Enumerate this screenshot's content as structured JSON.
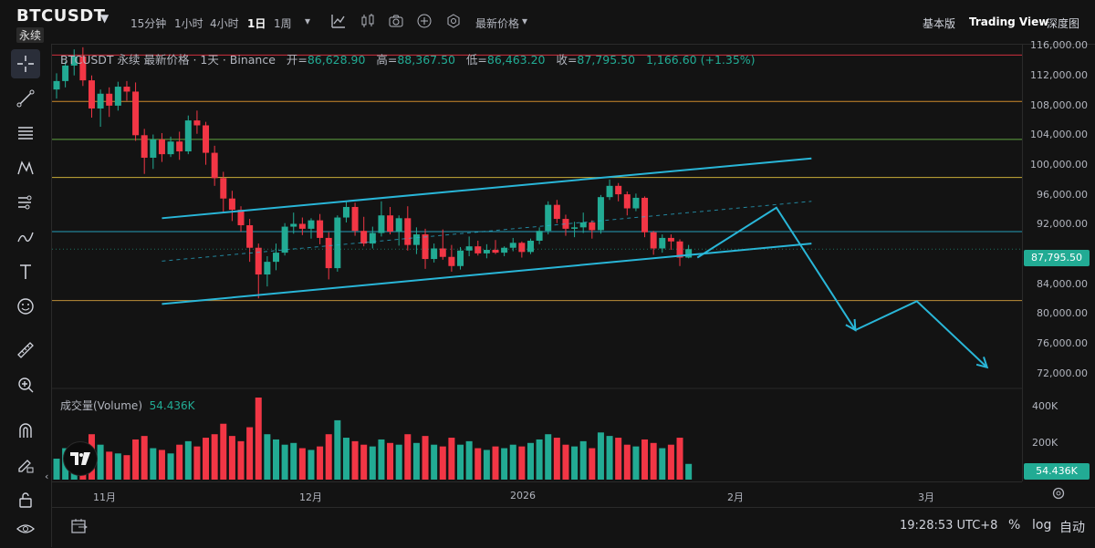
{
  "header": {
    "symbol": "BTCUSDT",
    "contract": "永续",
    "timeframes": [
      "15分钟",
      "1小时",
      "4小时",
      "1日",
      "1周"
    ],
    "active_timeframe": "1日",
    "price_type": "最新价格",
    "right_tabs": [
      "基本版",
      "Trading View",
      "深度图"
    ]
  },
  "legend": {
    "title": "BTCUSDT 永续 最新价格 · 1天 · Binance",
    "open_label": "开=",
    "open": "86,628.90",
    "high_label": "高=",
    "high": "88,367.50",
    "low_label": "低=",
    "low": "86,463.20",
    "close_label": "收=",
    "close": "87,795.50",
    "change": "1,166.60 (+1.35%)"
  },
  "volume": {
    "label": "成交量(Volume)",
    "value": "54.436K",
    "axis_ticks": [
      "400K",
      "200K"
    ],
    "tag": "54.436K"
  },
  "price_axis": {
    "ticks": [
      "116,000.00",
      "112,000.00",
      "108,000.00",
      "104,000.00",
      "100,000.00",
      "96,000.00",
      "92,000.00",
      "88,000.00",
      "84,000.00",
      "80,000.00",
      "76,000.00",
      "72,000.00"
    ],
    "current": "87,795.50"
  },
  "time_axis": {
    "labels": [
      "11月",
      "12月",
      "2026",
      "2月",
      "3月"
    ]
  },
  "footer": {
    "time": "19:28:53 UTC+8",
    "percent": "%",
    "log": "log",
    "auto": "自动"
  },
  "colors": {
    "up": "#22ab94",
    "down": "#f23645",
    "channel": "#29b6d8",
    "bg": "#131313"
  },
  "left_tools": [
    "crosshair-icon",
    "trend-line-icon",
    "fib-icon",
    "pattern-icon",
    "prediction-icon",
    "brush-icon",
    "text-icon",
    "emoji-icon",
    "ruler-icon",
    "zoom-in-icon",
    "magnet-icon",
    "lock-draw-icon",
    "lock-icon",
    "eye-icon"
  ],
  "chart_data": {
    "type": "candlestick",
    "price_min": 68000,
    "price_max": 117000,
    "horizontal_levels": [
      {
        "price": 115400,
        "color": "#f23645"
      },
      {
        "price": 108800,
        "color": "#f0a030"
      },
      {
        "price": 103400,
        "color": "#6fbf4a"
      },
      {
        "price": 98000,
        "color": "#e8c840"
      },
      {
        "price": 90300,
        "color": "#29b6d8"
      },
      {
        "price": 80500,
        "color": "#d9a441"
      }
    ],
    "candles": [
      [
        110500,
        112800,
        109200,
        111700
      ],
      [
        111700,
        114500,
        110800,
        113900
      ],
      [
        113900,
        116200,
        112500,
        115200
      ],
      [
        115200,
        116500,
        111000,
        111800
      ],
      [
        111800,
        112500,
        106500,
        107800
      ],
      [
        107800,
        110500,
        105200,
        109900
      ],
      [
        109900,
        110800,
        106600,
        108200
      ],
      [
        108200,
        111600,
        107500,
        110900
      ],
      [
        110900,
        111700,
        108900,
        110200
      ],
      [
        110200,
        111500,
        103200,
        104000
      ],
      [
        104000,
        104900,
        98500,
        100800
      ],
      [
        100800,
        104100,
        99200,
        103400
      ],
      [
        103400,
        104300,
        100200,
        101300
      ],
      [
        101300,
        103800,
        100900,
        103100
      ],
      [
        103100,
        104500,
        100500,
        101700
      ],
      [
        101700,
        106800,
        101300,
        106100
      ],
      [
        106100,
        107500,
        104200,
        105400
      ],
      [
        105400,
        105900,
        99800,
        101500
      ],
      [
        101500,
        102500,
        96800,
        97900
      ],
      [
        97900,
        98800,
        92900,
        95000
      ],
      [
        95000,
        96100,
        91800,
        93400
      ],
      [
        93400,
        93900,
        90300,
        91200
      ],
      [
        91200,
        92100,
        86000,
        88000
      ],
      [
        88000,
        88600,
        80800,
        84200
      ],
      [
        84200,
        86800,
        82500,
        86000
      ],
      [
        86000,
        88600,
        84800,
        87300
      ],
      [
        87300,
        91500,
        86900,
        91000
      ],
      [
        91000,
        93000,
        90000,
        91400
      ],
      [
        91400,
        92300,
        89800,
        90700
      ],
      [
        90700,
        92200,
        89300,
        91900
      ],
      [
        91900,
        92800,
        88500,
        89400
      ],
      [
        89400,
        90200,
        83500,
        85100
      ],
      [
        85100,
        92600,
        84600,
        92300
      ],
      [
        92300,
        94500,
        91600,
        93800
      ],
      [
        93800,
        94400,
        89700,
        90400
      ],
      [
        90400,
        92400,
        88200,
        88600
      ],
      [
        88600,
        91000,
        87900,
        90100
      ],
      [
        90100,
        94600,
        89600,
        92600
      ],
      [
        92600,
        93800,
        89900,
        90300
      ],
      [
        90300,
        92600,
        88300,
        92200
      ],
      [
        92200,
        93900,
        87600,
        88400
      ],
      [
        88400,
        90900,
        87100,
        89900
      ],
      [
        89900,
        90700,
        85000,
        86400
      ],
      [
        86400,
        88600,
        85900,
        87900
      ],
      [
        87900,
        90600,
        86300,
        86700
      ],
      [
        86700,
        88400,
        84600,
        85400
      ],
      [
        85400,
        88100,
        84900,
        87600
      ],
      [
        87600,
        89600,
        86800,
        88200
      ],
      [
        88200,
        89000,
        86900,
        87200
      ],
      [
        87200,
        88500,
        86500,
        87700
      ],
      [
        87700,
        89100,
        87100,
        87300
      ],
      [
        87300,
        88200,
        86800,
        88000
      ],
      [
        88000,
        89400,
        87500,
        88700
      ],
      [
        88700,
        88900,
        86600,
        87400
      ],
      [
        87400,
        89300,
        87100,
        89000
      ],
      [
        89000,
        90900,
        88500,
        90400
      ],
      [
        90400,
        94600,
        89900,
        94100
      ],
      [
        94100,
        94800,
        91500,
        92100
      ],
      [
        92100,
        92700,
        89700,
        90700
      ],
      [
        90700,
        91700,
        89500,
        90900
      ],
      [
        90900,
        93000,
        90100,
        91600
      ],
      [
        91600,
        91900,
        89300,
        90500
      ],
      [
        90500,
        95500,
        90000,
        95200
      ],
      [
        95200,
        97700,
        94800,
        96800
      ],
      [
        96800,
        97200,
        94600,
        95600
      ],
      [
        95600,
        96000,
        92600,
        93600
      ],
      [
        93600,
        95700,
        93200,
        95100
      ],
      [
        95100,
        95300,
        89500,
        90200
      ],
      [
        90200,
        90400,
        87000,
        87900
      ],
      [
        87900,
        89900,
        87300,
        89400
      ],
      [
        89400,
        89900,
        87700,
        88900
      ],
      [
        88900,
        89200,
        85400,
        86600
      ],
      [
        86600,
        88400,
        86500,
        87800
      ]
    ],
    "volumes": [
      120,
      180,
      150,
      210,
      260,
      200,
      160,
      150,
      140,
      230,
      250,
      180,
      170,
      150,
      200,
      220,
      190,
      240,
      260,
      320,
      250,
      220,
      300,
      470,
      260,
      230,
      200,
      210,
      180,
      170,
      190,
      260,
      340,
      240,
      220,
      200,
      190,
      230,
      210,
      200,
      260,
      210,
      250,
      200,
      190,
      240,
      200,
      220,
      180,
      170,
      190,
      180,
      200,
      190,
      210,
      230,
      260,
      240,
      200,
      190,
      220,
      180,
      270,
      250,
      240,
      200,
      190,
      230,
      210,
      180,
      200,
      240,
      90
    ],
    "channel": {
      "upper": [
        [
          12,
          92200
        ],
        [
          86,
          100700
        ]
      ],
      "lower": [
        [
          12,
          80000
        ],
        [
          86,
          88600
        ]
      ],
      "mid": [
        [
          12,
          86100
        ],
        [
          86,
          94600
        ]
      ]
    },
    "projection": [
      [
        73,
        86600
      ],
      [
        82,
        93700
      ],
      [
        91,
        76300
      ],
      [
        98,
        80400
      ],
      [
        106,
        71000
      ]
    ]
  }
}
